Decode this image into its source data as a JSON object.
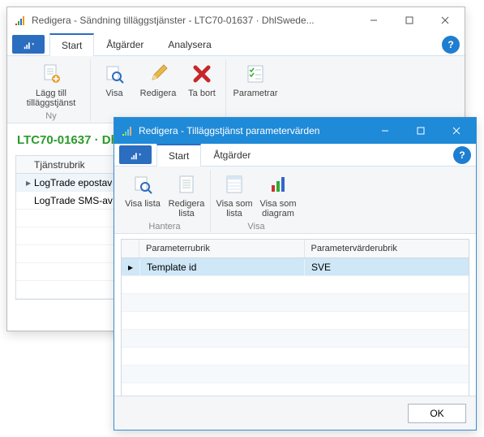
{
  "bg_window": {
    "title": "Redigera - Sändning tilläggstjänster - LTC70-01637 · DhlSwede...",
    "menubar": {
      "dropdown": "▾",
      "tabs": [
        "Start",
        "Åtgärder",
        "Analysera"
      ]
    },
    "ribbon": {
      "groups": [
        {
          "label": "Ny",
          "buttons": [
            {
              "name": "add-service",
              "label": "Lägg till tilläggstjänst",
              "icon": "doc-plus"
            }
          ]
        },
        {
          "label": "",
          "buttons": [
            {
              "name": "show",
              "label": "Visa",
              "icon": "magnifier"
            },
            {
              "name": "edit",
              "label": "Redigera",
              "icon": "pencil"
            },
            {
              "name": "delete",
              "label": "Ta bort",
              "icon": "x-red"
            }
          ]
        },
        {
          "label": "",
          "buttons": [
            {
              "name": "params",
              "label": "Parametrar",
              "icon": "checklist"
            }
          ]
        }
      ]
    },
    "heading": "LTC70-01637 · Dh",
    "list": {
      "header": "Tjänstrubrik",
      "rows": [
        "LogTrade epostav",
        "LogTrade SMS-av"
      ]
    }
  },
  "fg_window": {
    "title": "Redigera - Tilläggstjänst parametervärden",
    "menubar": {
      "dropdown": "▾",
      "tabs": [
        "Start",
        "Åtgärder"
      ]
    },
    "ribbon": {
      "groups": [
        {
          "label": "Hantera",
          "buttons": [
            {
              "name": "show-list",
              "label": "Visa lista",
              "icon": "magnifier"
            },
            {
              "name": "edit-list",
              "label": "Redigera lista",
              "icon": "doc-lines"
            }
          ]
        },
        {
          "label": "Visa",
          "buttons": [
            {
              "name": "show-as-list",
              "label": "Visa som lista",
              "icon": "list"
            },
            {
              "name": "show-as-chart",
              "label": "Visa som diagram",
              "icon": "chart"
            }
          ]
        }
      ]
    },
    "grid": {
      "headers": [
        "Parameterrubrik",
        "Parametervärderubrik"
      ],
      "rows": [
        {
          "cells": [
            "Template id",
            "SVE"
          ],
          "selected": true
        }
      ]
    },
    "footer": {
      "ok": "OK"
    }
  }
}
